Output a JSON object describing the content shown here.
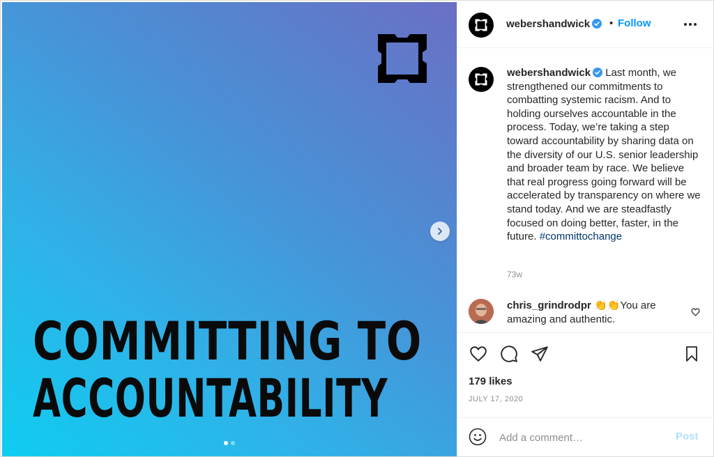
{
  "media": {
    "headline_line1": "COMMITTING TO",
    "headline_line2": "ACCOUNTABILITY",
    "slide_count": 2,
    "active_slide": 1,
    "gradient_colors": [
      "#0ecdf0",
      "#4a90d6",
      "#6a6fc4"
    ],
    "next_icon": "chevron-right-icon"
  },
  "header": {
    "username": "webershandwick",
    "verified": true,
    "separator": "•",
    "follow_label": "Follow",
    "more_icon": "more-horizontal-icon"
  },
  "caption": {
    "username": "webershandwick",
    "text": "Last month, we strengthened our commitments to combatting systemic racism. And to holding ourselves accountable in the process. Today, we’re taking a step toward accountability by sharing data on the diversity of our U.S. senior leadership and broader team by race. We believe that real progress going forward will be accelerated by transparency on where we stand today. And we are steadfastly focused on doing better, faster, in the future.",
    "hashtag": "#committochange",
    "time_ago": "73w"
  },
  "comment": {
    "username": "chris_grindrodpr",
    "emoji": "👏👏",
    "text": "You are amazing and authentic.",
    "like_icon": "heart-outline-icon"
  },
  "actions": {
    "like_icon": "heart-icon",
    "comment_icon": "comment-icon",
    "share_icon": "send-icon",
    "save_icon": "bookmark-icon"
  },
  "likes": "179 likes",
  "date": "JULY 17, 2020",
  "add_comment": {
    "placeholder": "Add a comment…",
    "post_label": "Post",
    "emoji_icon": "smiley-icon"
  },
  "colors": {
    "accent": "#0095f6",
    "hashtag": "#00376b",
    "muted": "#8e8e8e",
    "verified": "#3897f0"
  }
}
